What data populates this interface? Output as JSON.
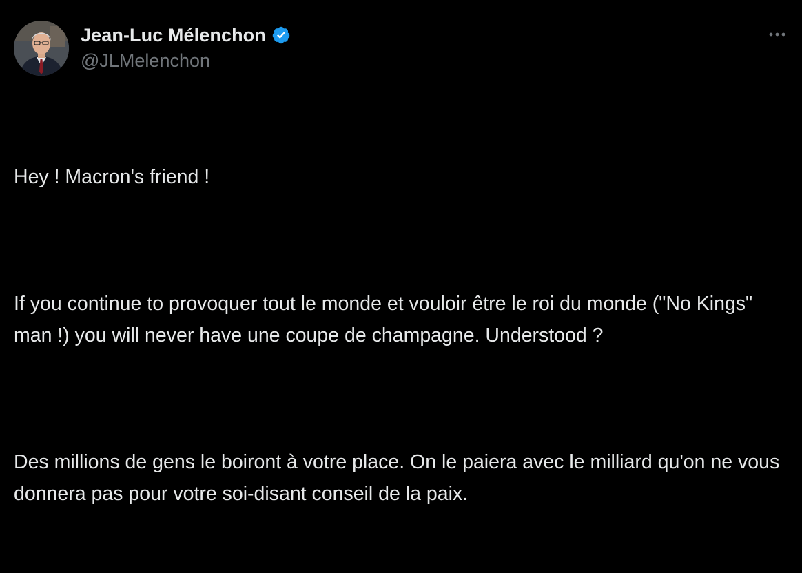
{
  "author": {
    "name": "Jean-Luc Mélenchon",
    "handle": "@JLMelenchon",
    "verified": true,
    "verified_color": "#1d9bf0",
    "avatar_icon": "profile-photo"
  },
  "more_icon": "more-options-icon",
  "tweet": {
    "paragraphs": [
      "Hey ! Macron's friend !",
      "If you continue to provoquer tout le monde et vouloir être le roi du monde (\"No Kings\" man !) you will never have une coupe de champagne. Understood ?",
      "Des millions de gens le boiront à votre place. On le paiera avec le milliard qu'on ne vous donnera pas pour votre soi-disant conseil de la paix."
    ]
  },
  "colors": {
    "background": "#000000",
    "text": "#e7e9ea",
    "secondary_text": "#71767b",
    "accent": "#1d9bf0"
  }
}
